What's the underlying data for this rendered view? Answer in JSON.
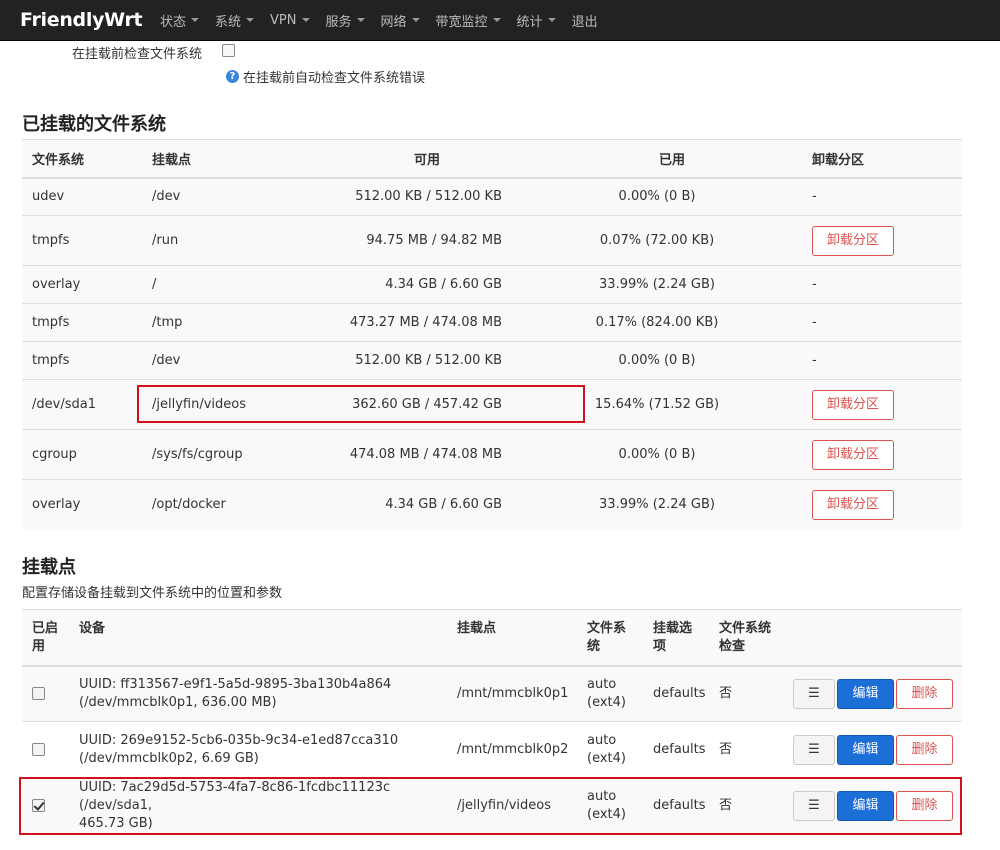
{
  "nav": {
    "brand": "FriendlyWrt",
    "items": [
      {
        "label": "状态",
        "dropdown": true
      },
      {
        "label": "系统",
        "dropdown": true
      },
      {
        "label": "VPN",
        "dropdown": true
      },
      {
        "label": "服务",
        "dropdown": true
      },
      {
        "label": "网络",
        "dropdown": true
      },
      {
        "label": "带宽监控",
        "dropdown": true
      },
      {
        "label": "统计",
        "dropdown": true
      },
      {
        "label": "退出",
        "dropdown": false
      }
    ]
  },
  "check_option": {
    "label": "在挂载前检查文件系统",
    "checked": false,
    "help": "在挂载前自动检查文件系统错误"
  },
  "mounted": {
    "title": "已挂载的文件系统",
    "headers": [
      "文件系统",
      "挂载点",
      "可用",
      "已用",
      "卸载分区"
    ],
    "unmount_label": "卸载分区",
    "rows": [
      {
        "fs": "udev",
        "mount": "/dev",
        "avail": "512.00 KB / 512.00 KB",
        "used": "0.00% (0 B)",
        "action": "-"
      },
      {
        "fs": "tmpfs",
        "mount": "/run",
        "avail": "94.75 MB / 94.82 MB",
        "used": "0.07% (72.00 KB)",
        "action": "button"
      },
      {
        "fs": "overlay",
        "mount": "/",
        "avail": "4.34 GB / 6.60 GB",
        "used": "33.99% (2.24 GB)",
        "action": "-"
      },
      {
        "fs": "tmpfs",
        "mount": "/tmp",
        "avail": "473.27 MB / 474.08 MB",
        "used": "0.17% (824.00 KB)",
        "action": "-"
      },
      {
        "fs": "tmpfs",
        "mount": "/dev",
        "avail": "512.00 KB / 512.00 KB",
        "used": "0.00% (0 B)",
        "action": "-"
      },
      {
        "fs": "/dev/sda1",
        "mount": "/jellyfin/videos",
        "avail": "362.60 GB / 457.42 GB",
        "used": "15.64% (71.52 GB)",
        "action": "button"
      },
      {
        "fs": "cgroup",
        "mount": "/sys/fs/cgroup",
        "avail": "474.08 MB / 474.08 MB",
        "used": "0.00% (0 B)",
        "action": "button"
      },
      {
        "fs": "overlay",
        "mount": "/opt/docker",
        "avail": "4.34 GB / 6.60 GB",
        "used": "33.99% (2.24 GB)",
        "action": "button"
      }
    ]
  },
  "mountpoints": {
    "title": "挂载点",
    "description": "配置存储设备挂载到文件系统中的位置和参数",
    "headers": {
      "enabled": [
        "已启",
        "用"
      ],
      "device": "设备",
      "mount": "挂载点",
      "fs": [
        "文件系",
        "统"
      ],
      "options": [
        "挂载选",
        "项"
      ],
      "check": [
        "文件系统",
        "检查"
      ]
    },
    "menu_label": "☰",
    "edit_label": "编辑",
    "delete_label": "删除",
    "rows": [
      {
        "enabled": false,
        "device1": "UUID: ff313567-e9f1-5a5d-9895-3ba130b4a864",
        "device2": "(/dev/mmcblk0p1, 636.00 MB)",
        "mount": "/mnt/mmcblk0p1",
        "fs1": "auto",
        "fs2": "(ext4)",
        "options": "defaults",
        "check": "否"
      },
      {
        "enabled": false,
        "device1": "UUID: 269e9152-5cb6-035b-9c34-e1ed87cca310",
        "device2": "(/dev/mmcblk0p2, 6.69 GB)",
        "mount": "/mnt/mmcblk0p2",
        "fs1": "auto",
        "fs2": "(ext4)",
        "options": "defaults",
        "check": "否"
      },
      {
        "enabled": true,
        "device1": "UUID: 7ac29d5d-5753-4fa7-8c86-1fcdbc11123c (/dev/sda1,",
        "device2": "465.73 GB)",
        "mount": "/jellyfin/videos",
        "fs1": "auto",
        "fs2": "(ext4)",
        "options": "defaults",
        "check": "否"
      }
    ]
  },
  "colors": {
    "navbar": "#222222",
    "danger": "#d9534f",
    "primary": "#1c6fd6",
    "highlight": "#d0101e"
  }
}
